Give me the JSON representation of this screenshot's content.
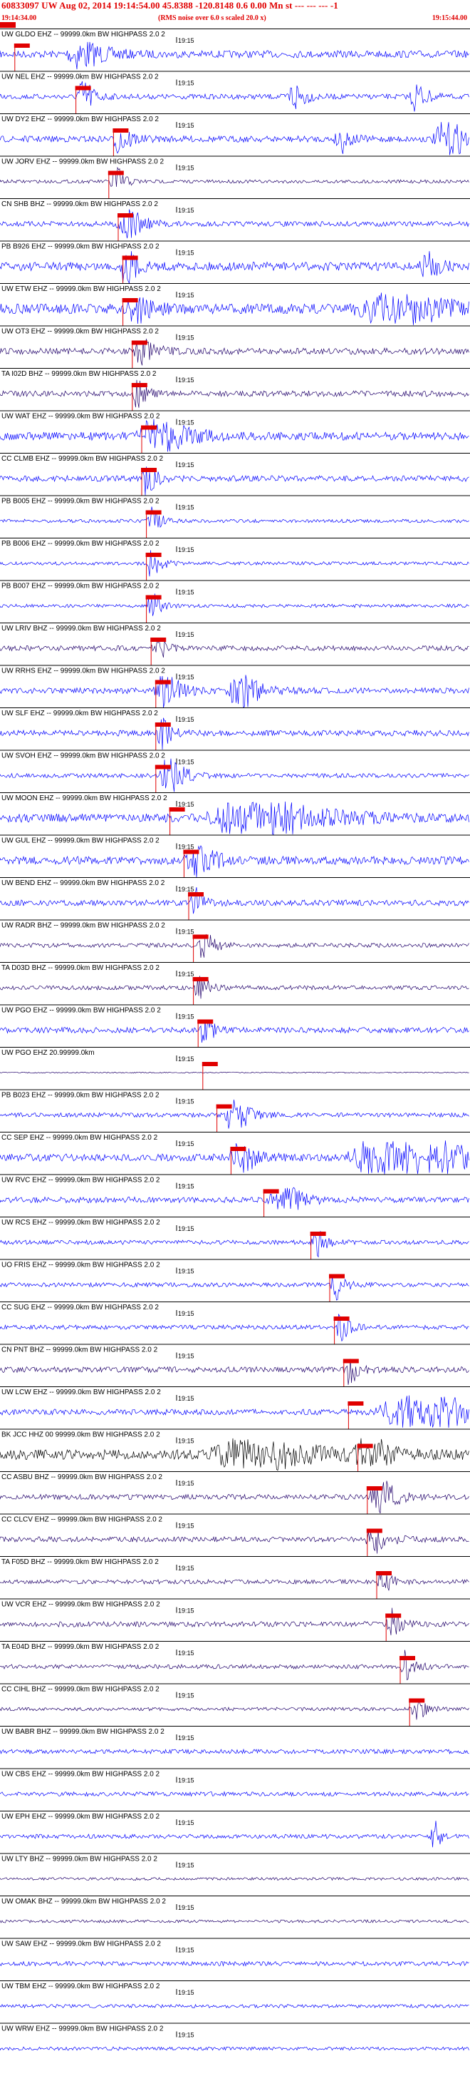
{
  "header": {
    "title": "60833097 UW Aug 02, 2014 19:14:54.00   45.8388  -120.8148   0.6  0.00  Mn  st  ---  ---  ---  -1",
    "start_time": "19:14:34.00",
    "end_time": "19:15:44.00",
    "note": "(RMS noise over 6.0 s scaled 20.0 x)"
  },
  "minute_label": "19:15",
  "colors": {
    "trace": "#0000ff",
    "trace_alt": "#000000",
    "trace_dark": "#20006a",
    "pick": "#e00000",
    "separator": "#000000"
  },
  "traces": [
    {
      "label": "UW GLDO EHZ -- 99999.0km BW  HIGHPASS  2.0  2",
      "pick": 0.03,
      "color": "blue",
      "amp": 0.25,
      "bursts": [
        [
          0.16,
          0.05,
          1.6
        ]
      ]
    },
    {
      "label": "UW NEL EHZ -- 99999.0km BW  HIGHPASS  2.0  2",
      "pick": 0.16,
      "color": "blue",
      "amp": 0.18,
      "bursts": [
        [
          0.17,
          0.02,
          3
        ],
        [
          0.62,
          0.02,
          2.5
        ],
        [
          0.88,
          0.02,
          2
        ]
      ]
    },
    {
      "label": "UW DY2 EHZ -- 99999.0km BW  HIGHPASS  2.0  2",
      "pick": 0.24,
      "color": "blue",
      "amp": 0.22,
      "bursts": [
        [
          0.25,
          0.02,
          2.5
        ],
        [
          0.72,
          0.02,
          1.5
        ],
        [
          0.94,
          0.04,
          2.5
        ]
      ]
    },
    {
      "label": "UW JORV EHZ -- 99999.0km BW  HIGHPASS  2.0  2",
      "pick": 0.23,
      "color": "dark",
      "amp": 0.12,
      "bursts": [
        [
          0.24,
          0.02,
          2
        ]
      ]
    },
    {
      "label": "CN SHB BHZ -- 99999.0km BW  HIGHPASS  2.0  2",
      "pick": 0.25,
      "color": "blue",
      "amp": 0.18,
      "bursts": [
        [
          0.26,
          0.03,
          2.5
        ]
      ]
    },
    {
      "label": "PB B926 EHZ -- 99999.0km BW  HIGHPASS  2.0  2",
      "pick": 0.26,
      "color": "blue",
      "amp": 0.3,
      "bursts": [
        [
          0.26,
          0.02,
          3
        ],
        [
          0.9,
          0.02,
          2.5
        ]
      ]
    },
    {
      "label": "UW ETW EHZ -- 99999.0km BW  HIGHPASS  2.0  2",
      "pick": 0.26,
      "color": "blue",
      "amp": 0.35,
      "bursts": [
        [
          0.27,
          0.03,
          2.5
        ],
        [
          0.8,
          0.1,
          2.5
        ]
      ]
    },
    {
      "label": "UW OT3 EHZ -- 99999.0km BW  HIGHPASS  2.0  2",
      "pick": 0.28,
      "color": "dark",
      "amp": 0.22,
      "bursts": [
        [
          0.29,
          0.03,
          1.5
        ]
      ]
    },
    {
      "label": "TA I02D BHZ -- 99999.0km BW  HIGHPASS  2.0  2",
      "pick": 0.28,
      "color": "dark",
      "amp": 0.2,
      "bursts": [
        [
          0.29,
          0.02,
          1.2
        ]
      ]
    },
    {
      "label": "UW WAT EHZ -- 99999.0km BW  HIGHPASS  2.0  2",
      "pick": 0.3,
      "color": "blue",
      "amp": 0.28,
      "bursts": [
        [
          0.32,
          0.06,
          2.2
        ]
      ]
    },
    {
      "label": "CC CLMB EHZ -- 99999.0km BW  HIGHPASS  2.0  2",
      "pick": 0.3,
      "color": "blue",
      "amp": 0.2,
      "bursts": [
        [
          0.31,
          0.02,
          1.5
        ]
      ]
    },
    {
      "label": "PB B005 EHZ -- 99999.0km BW  HIGHPASS  2.0  2",
      "pick": 0.31,
      "color": "blue",
      "amp": 0.12,
      "bursts": [
        [
          0.32,
          0.02,
          1.5
        ]
      ]
    },
    {
      "label": "PB B006 EHZ -- 99999.0km BW  HIGHPASS  2.0  2",
      "pick": 0.31,
      "color": "blue",
      "amp": 0.12,
      "bursts": [
        [
          0.32,
          0.02,
          1.5
        ]
      ]
    },
    {
      "label": "PB B007 EHZ -- 99999.0km BW  HIGHPASS  2.0  2",
      "pick": 0.31,
      "color": "blue",
      "amp": 0.12,
      "bursts": [
        [
          0.32,
          0.02,
          1.5
        ]
      ]
    },
    {
      "label": "UW LRIV BHZ -- 99999.0km BW  HIGHPASS  2.0  2",
      "pick": 0.32,
      "color": "dark",
      "amp": 0.18,
      "bursts": [
        [
          0.33,
          0.02,
          1.4
        ]
      ]
    },
    {
      "label": "UW RRHS EHZ -- 99999.0km BW  HIGHPASS  2.0  2",
      "pick": 0.33,
      "color": "blue",
      "amp": 0.2,
      "bursts": [
        [
          0.34,
          0.03,
          2.8
        ],
        [
          0.5,
          0.04,
          2.2
        ]
      ]
    },
    {
      "label": "UW SLF EHZ -- 99999.0km BW  HIGHPASS  2.0  2",
      "pick": 0.33,
      "color": "blue",
      "amp": 0.2,
      "bursts": [
        [
          0.34,
          0.02,
          1.5
        ]
      ]
    },
    {
      "label": "UW SVOH EHZ -- 99999.0km BW  HIGHPASS  2.0  2",
      "pick": 0.33,
      "color": "blue",
      "amp": 0.15,
      "bursts": [
        [
          0.35,
          0.03,
          2.5
        ]
      ]
    },
    {
      "label": "UW MOON EHZ -- 99999.0km BW  HIGHPASS  2.0  2",
      "pick": 0.36,
      "color": "blue",
      "amp": 0.3,
      "bursts": [
        [
          0.5,
          0.12,
          3
        ]
      ]
    },
    {
      "label": "UW GUL EHZ -- 99999.0km BW  HIGHPASS  2.0  2",
      "pick": 0.39,
      "color": "blue",
      "amp": 0.28,
      "bursts": [
        [
          0.41,
          0.04,
          1.8
        ]
      ]
    },
    {
      "label": "UW BEND EHZ -- 99999.0km BW  HIGHPASS  2.0  2",
      "pick": 0.4,
      "color": "blue",
      "amp": 0.2,
      "bursts": [
        [
          0.41,
          0.02,
          1.5
        ]
      ]
    },
    {
      "label": "UW RADR BHZ -- 99999.0km BW  HIGHPASS  2.0  2",
      "pick": 0.41,
      "color": "dark",
      "amp": 0.15,
      "bursts": [
        [
          0.43,
          0.02,
          2
        ]
      ]
    },
    {
      "label": "TA D03D BHZ -- 99999.0km BW  HIGHPASS  2.0  2",
      "pick": 0.41,
      "color": "dark",
      "amp": 0.15,
      "bursts": [
        [
          0.42,
          0.02,
          1.5
        ]
      ]
    },
    {
      "label": "UW PGO EHZ -- 99999.0km BW  HIGHPASS  2.0  2",
      "pick": 0.42,
      "color": "blue",
      "amp": 0.2,
      "bursts": [
        [
          0.43,
          0.02,
          1.5
        ]
      ]
    },
    {
      "label": "UW PGO EHZ 20.99999.0km",
      "pick": 0.43,
      "color": "dark",
      "amp": 0.04,
      "bursts": []
    },
    {
      "label": "PB B023 EHZ -- 99999.0km BW  HIGHPASS  2.0  2",
      "pick": 0.46,
      "color": "blue",
      "amp": 0.15,
      "bursts": [
        [
          0.49,
          0.03,
          2.5
        ]
      ]
    },
    {
      "label": "CC SEP EHZ -- 99999.0km BW  HIGHPASS  2.0  2",
      "pick": 0.49,
      "color": "blue",
      "amp": 0.25,
      "bursts": [
        [
          0.5,
          0.03,
          2.5
        ],
        [
          0.8,
          0.12,
          4.5
        ]
      ]
    },
    {
      "label": "UW RVC EHZ -- 99999.0km BW  HIGHPASS  2.0  2",
      "pick": 0.56,
      "color": "blue",
      "amp": 0.2,
      "bursts": [
        [
          0.59,
          0.04,
          2
        ]
      ]
    },
    {
      "label": "UW RCS EHZ -- 99999.0km BW  HIGHPASS  2.0  2",
      "pick": 0.66,
      "color": "blue",
      "amp": 0.15,
      "bursts": [
        [
          0.67,
          0.02,
          1.5
        ]
      ]
    },
    {
      "label": "UO FRIS EHZ -- 99999.0km BW  HIGHPASS  2.0  2",
      "pick": 0.7,
      "color": "blue",
      "amp": 0.15,
      "bursts": [
        [
          0.71,
          0.02,
          1.5
        ]
      ]
    },
    {
      "label": "CC SUG EHZ -- 99999.0km BW  HIGHPASS  2.0  2",
      "pick": 0.71,
      "color": "blue",
      "amp": 0.15,
      "bursts": [
        [
          0.72,
          0.02,
          1.5
        ]
      ]
    },
    {
      "label": "CN PNT BHZ -- 99999.0km BW  HIGHPASS  2.0  2",
      "pick": 0.73,
      "color": "dark",
      "amp": 0.2,
      "bursts": [
        [
          0.74,
          0.02,
          1.5
        ]
      ]
    },
    {
      "label": "UW LCW EHZ -- 99999.0km BW  HIGHPASS  2.0  2",
      "pick": 0.74,
      "color": "blue",
      "amp": 0.2,
      "bursts": [
        [
          0.85,
          0.1,
          3.5
        ]
      ]
    },
    {
      "label": "BK JCC HHZ 00 99999.0km BW  HIGHPASS  2.0  2",
      "pick": 0.76,
      "color": "black",
      "amp": 0.35,
      "bursts": [
        [
          0.5,
          0.12,
          2
        ],
        [
          0.77,
          0.03,
          3.5
        ]
      ]
    },
    {
      "label": "CC ASBU BHZ -- 99999.0km BW  HIGHPASS  2.0  2",
      "pick": 0.78,
      "color": "dark",
      "amp": 0.18,
      "bursts": [
        [
          0.8,
          0.03,
          2.5
        ]
      ]
    },
    {
      "label": "CC CLCV EHZ -- 99999.0km BW  HIGHPASS  2.0  2",
      "pick": 0.78,
      "color": "dark",
      "amp": 0.18,
      "bursts": [
        [
          0.79,
          0.03,
          2
        ]
      ]
    },
    {
      "label": "TA F05D BHZ -- 99999.0km BW  HIGHPASS  2.0  2",
      "pick": 0.8,
      "color": "dark",
      "amp": 0.15,
      "bursts": [
        [
          0.81,
          0.02,
          1.5
        ]
      ]
    },
    {
      "label": "UW VCR EHZ -- 99999.0km BW  HIGHPASS  2.0  2",
      "pick": 0.82,
      "color": "dark",
      "amp": 0.18,
      "bursts": [
        [
          0.83,
          0.02,
          1.5
        ]
      ]
    },
    {
      "label": "TA E04D BHZ -- 99999.0km BW  HIGHPASS  2.0  2",
      "pick": 0.85,
      "color": "dark",
      "amp": 0.15,
      "bursts": [
        [
          0.86,
          0.02,
          1.5
        ]
      ]
    },
    {
      "label": "CC CIHL BHZ -- 99999.0km BW  HIGHPASS  2.0  2",
      "pick": 0.87,
      "color": "dark",
      "amp": 0.12,
      "bursts": [
        [
          0.88,
          0.02,
          1.5
        ]
      ]
    },
    {
      "label": "UW BABR BHZ -- 99999.0km BW  HIGHPASS  2.0  2",
      "pick": null,
      "color": "blue",
      "amp": 0.15,
      "bursts": []
    },
    {
      "label": "UW CBS EHZ -- 99999.0km BW  HIGHPASS  2.0  2",
      "pick": null,
      "color": "blue",
      "amp": 0.15,
      "bursts": []
    },
    {
      "label": "UW EPH EHZ -- 99999.0km BW  HIGHPASS  2.0  2",
      "pick": null,
      "color": "blue",
      "amp": 0.15,
      "bursts": [
        [
          0.92,
          0.01,
          3
        ]
      ]
    },
    {
      "label": "UW LTY BHZ -- 99999.0km BW  HIGHPASS  2.0  2",
      "pick": null,
      "color": "dark",
      "amp": 0.1,
      "bursts": []
    },
    {
      "label": "UW OMAK BHZ -- 99999.0km BW  HIGHPASS  2.0  2",
      "pick": null,
      "color": "dark",
      "amp": 0.1,
      "bursts": []
    },
    {
      "label": "UW SAW EHZ -- 99999.0km BW  HIGHPASS  2.0  2",
      "pick": null,
      "color": "blue",
      "amp": 0.15,
      "bursts": []
    },
    {
      "label": "UW TBM EHZ -- 99999.0km BW  HIGHPASS  2.0  2",
      "pick": null,
      "color": "blue",
      "amp": 0.12,
      "bursts": []
    },
    {
      "label": "UW WRW EHZ -- 99999.0km BW  HIGHPASS  2.0  2",
      "pick": null,
      "color": "blue",
      "amp": 0.12,
      "bursts": []
    }
  ]
}
